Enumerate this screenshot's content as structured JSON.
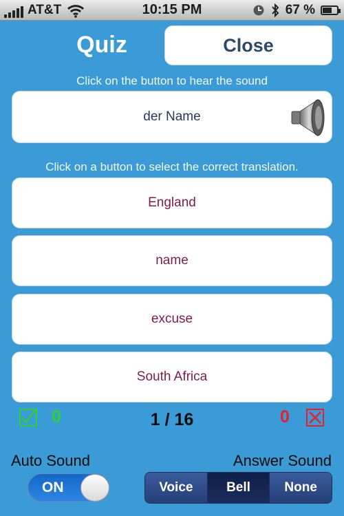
{
  "status_bar": {
    "carrier": "AT&T",
    "time": "10:15 PM",
    "battery": "67 %",
    "battery_level": 0.67,
    "icons": [
      "signal-icon",
      "wifi-icon",
      "clock-icon",
      "bluetooth-icon",
      "battery-icon"
    ]
  },
  "header": {
    "title": "Quiz",
    "close_label": "Close"
  },
  "prompt": {
    "hear_hint": "Click on the button to hear the sound",
    "word": "der Name",
    "speaker_icon": "speaker-icon"
  },
  "answers": {
    "hint": "Click on a button to select the correct translation.",
    "options": [
      "England",
      "name",
      "excuse",
      "South Africa"
    ]
  },
  "score": {
    "correct": "0",
    "progress": "1 / 16",
    "wrong": "0"
  },
  "settings": {
    "auto_sound_label": "Auto Sound",
    "auto_sound_state": "ON",
    "answer_sound_label": "Answer Sound",
    "answer_sound_options": [
      "Voice",
      "Bell",
      "None"
    ],
    "answer_sound_selected": "Bell"
  },
  "colors": {
    "background": "#3a9bd6",
    "answer_text": "#7d1b4c",
    "correct": "#2ed03a",
    "wrong": "#e8202a"
  }
}
